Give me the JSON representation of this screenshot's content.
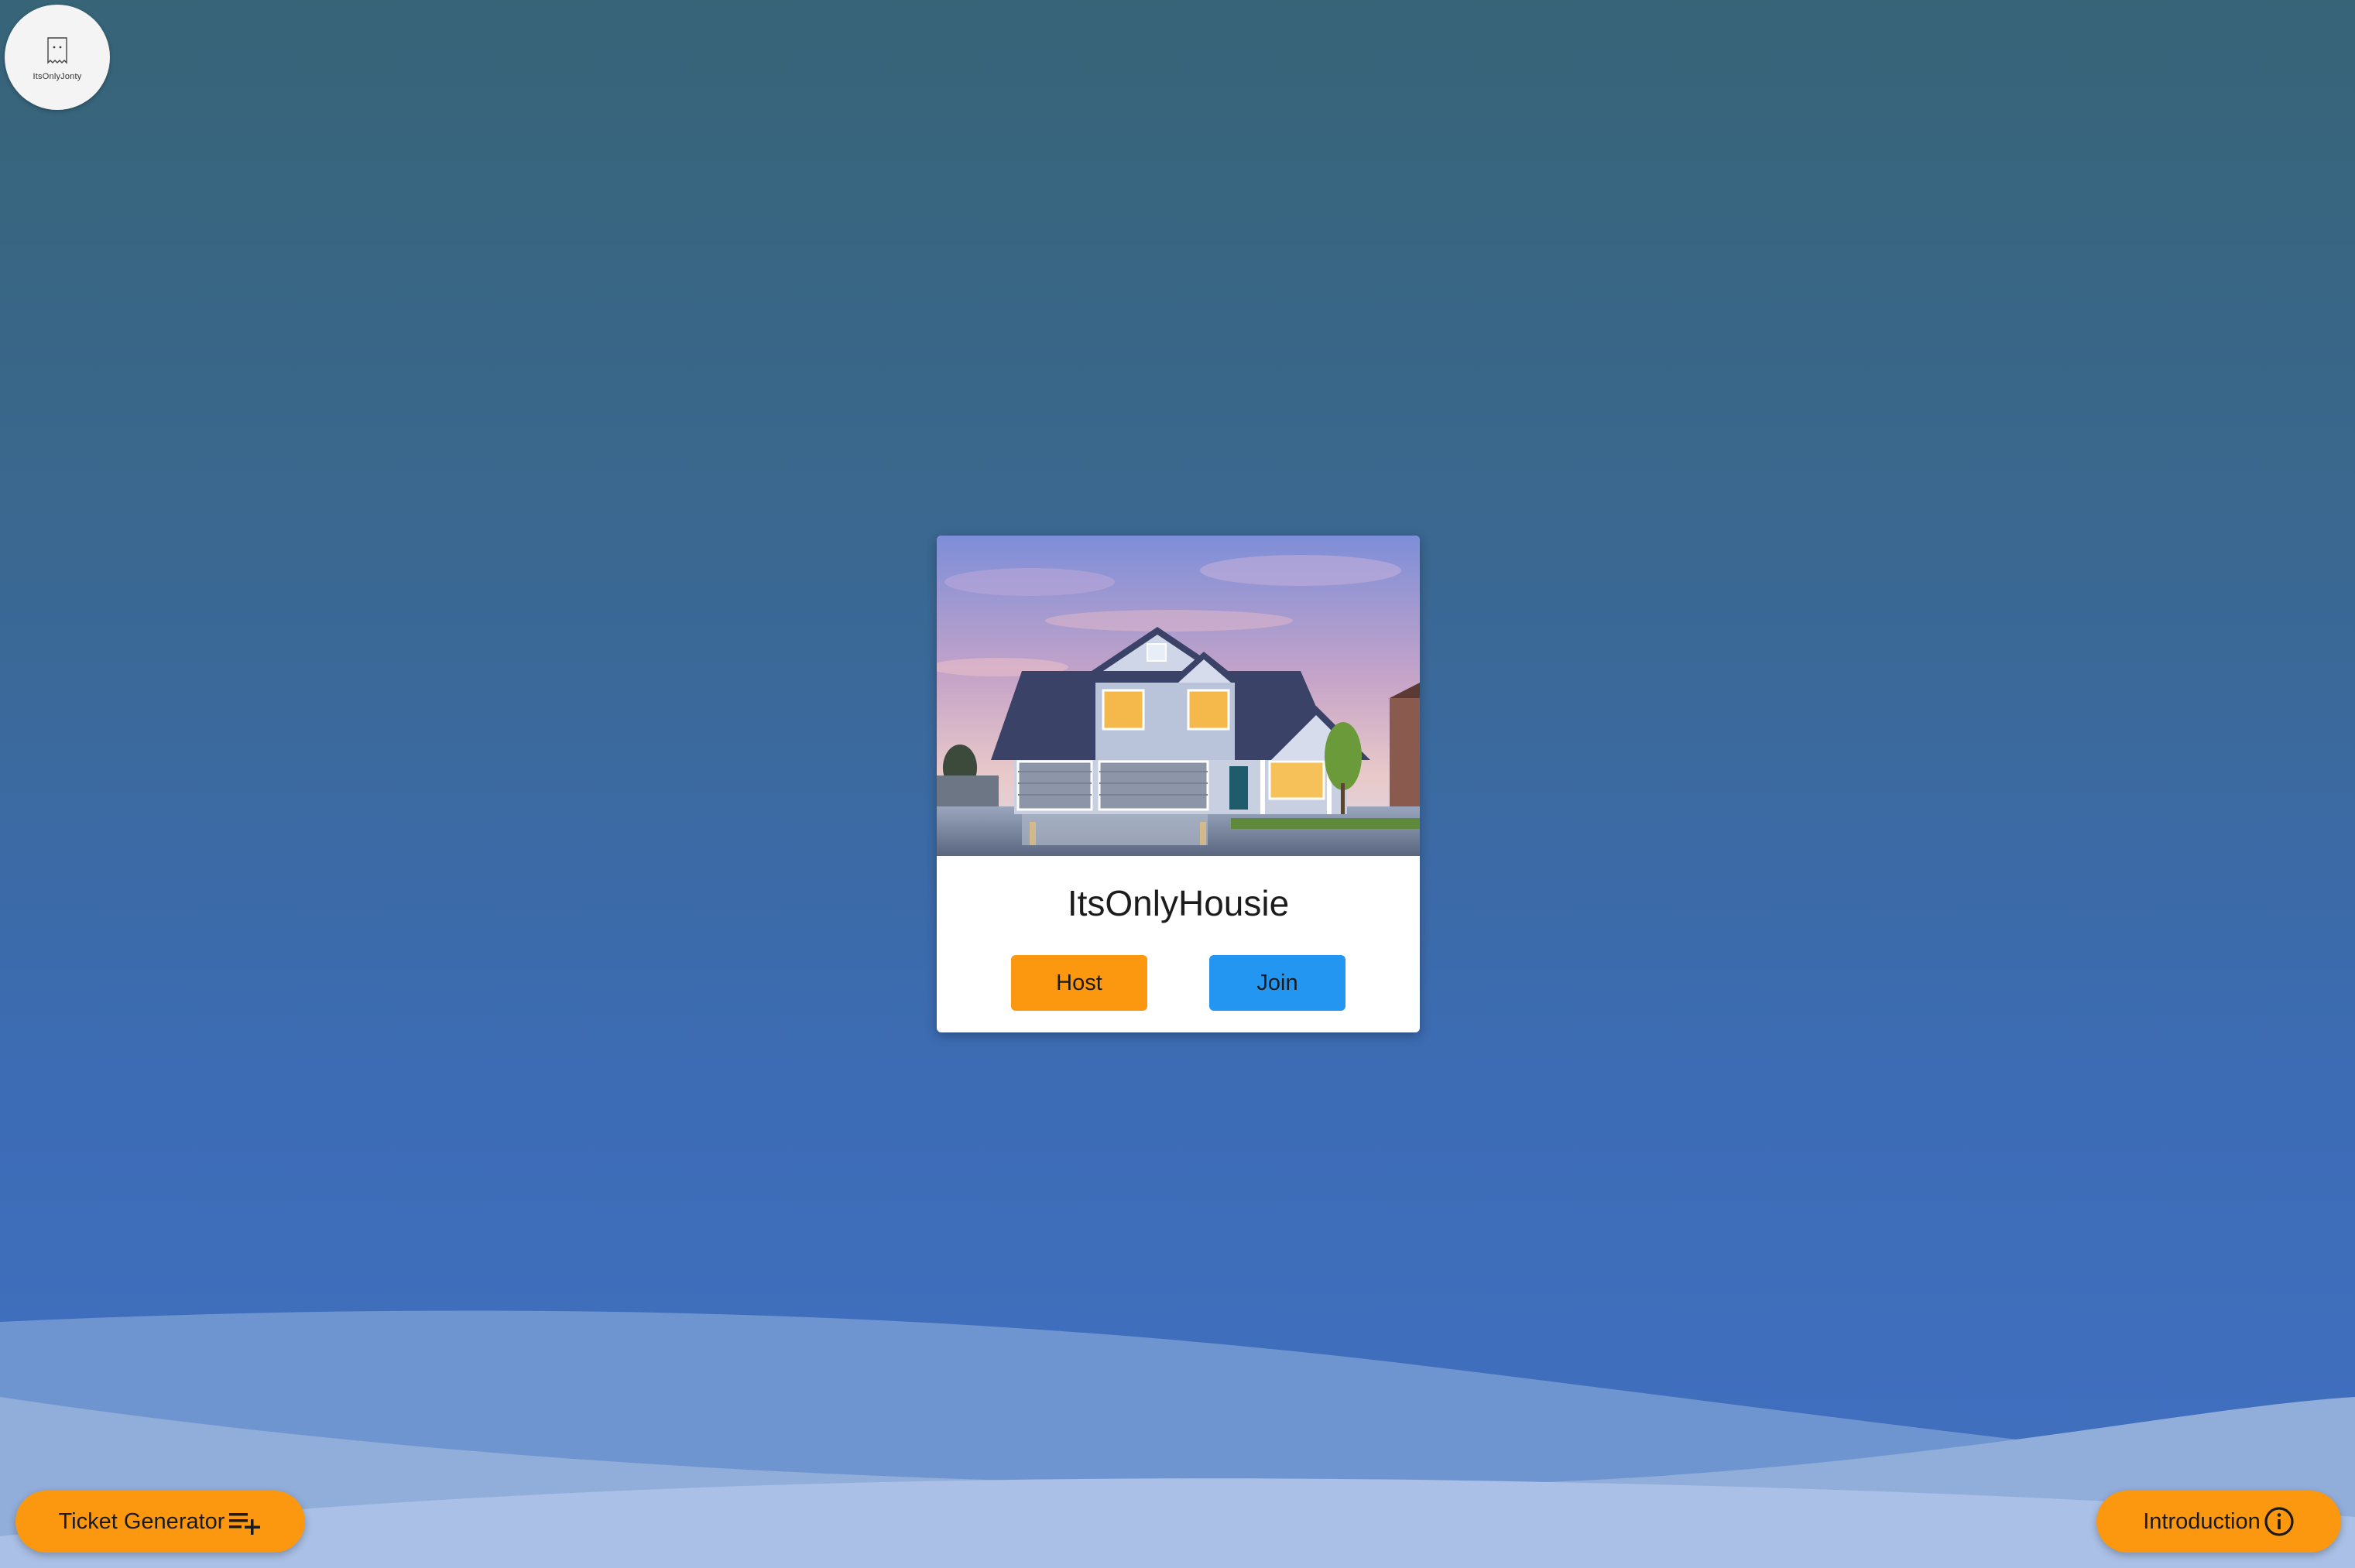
{
  "logo": {
    "text": "ItsOnlyJonty"
  },
  "card": {
    "image_alt": "House at dusk",
    "title": "ItsOnlyHousie",
    "host_label": "Host",
    "join_label": "Join"
  },
  "footer": {
    "ticket_generator_label": "Ticket Generator",
    "ticket_generator_icon": "playlist-add-icon",
    "introduction_label": "Introduction",
    "introduction_icon": "info-icon"
  },
  "colors": {
    "accent_orange": "#fb9810",
    "accent_blue": "#2396f2",
    "background_top": "#376477",
    "background_bottom": "#4170c2"
  }
}
